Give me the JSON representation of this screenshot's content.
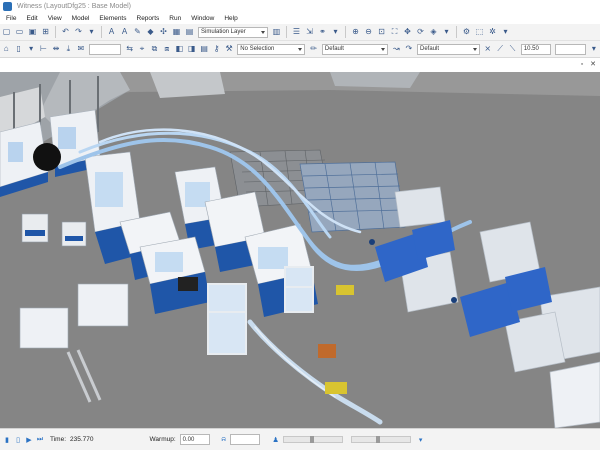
{
  "window": {
    "title": "Witness (LayoutDfg25 : Base Model)"
  },
  "menu": {
    "items": [
      "File",
      "Edit",
      "View",
      "Model",
      "Elements",
      "Reports",
      "Run",
      "Window",
      "Help"
    ]
  },
  "toolbar1": {
    "layer_select": "Simulation Layer"
  },
  "toolbar2": {
    "selection_select": "No Selection",
    "style_select_1": "Default",
    "style_select_2": "Default",
    "size_field": "10.50"
  },
  "statusbar": {
    "time_label": "Time:",
    "time_value": "235.770",
    "warmup_label": "Warmup:",
    "warmup_value": "0.00"
  },
  "icons": {
    "window_restore": "restore-icon",
    "window_close": "close-icon"
  },
  "colors": {
    "machine_blue": "#1f56a8",
    "machine_white": "#eef1f5",
    "floor_grey": "#7f7f7f",
    "conveyor_light_blue": "#9ec4ea",
    "rack_blue": "#6f8fb8"
  }
}
